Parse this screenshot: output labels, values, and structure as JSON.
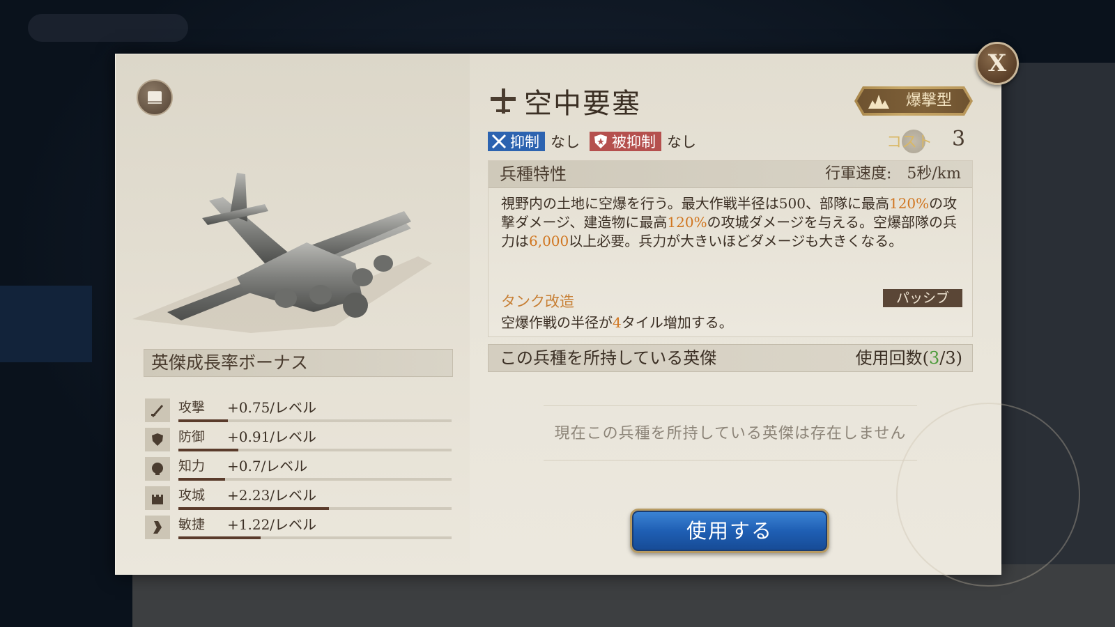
{
  "dialog": {
    "close_label": "X",
    "title": "空中要塞",
    "type_badge": "爆撃型",
    "counters": {
      "suppress_label": "抑制",
      "suppress_value": "なし",
      "suppressed_label": "被抑制",
      "suppressed_value": "なし"
    },
    "cost_label": "コスト",
    "cost_value": "3"
  },
  "traits": {
    "header": "兵種特性",
    "march_speed": "行軍速度:　5秒/km",
    "desc_parts": [
      "視野内の土地に空爆を行う。最大作戦半径は500、部隊に最高",
      "120%",
      "の攻撃ダメージ、建造物に最高",
      "120%",
      "の攻城ダメージを与える。空爆部隊の兵力は",
      "6,000",
      "以上必要。兵力が大きいほどダメージも大きくなる。"
    ],
    "skill_name": "タンク改造",
    "skill_tag": "パッシブ",
    "skill_desc_pre": "空爆作戦の半径が",
    "skill_desc_num": "4",
    "skill_desc_post": "タイル増加する。"
  },
  "heroes": {
    "header": "この兵種を所持している英傑",
    "usage_label": "使用回数(",
    "usage_current": "3",
    "usage_rest": "/3)",
    "empty_message": "現在この兵種を所持している英傑は存在しません"
  },
  "growth": {
    "header": "英傑成長率ボーナス",
    "stats": [
      {
        "label": "攻撃",
        "value": "+0.75/レベル",
        "fill": 0.18,
        "icon": "sword-icon"
      },
      {
        "label": "防御",
        "value": "+0.91/レベル",
        "fill": 0.22,
        "icon": "shield-icon"
      },
      {
        "label": "知力",
        "value": "+0.7/レベル",
        "fill": 0.17,
        "icon": "head-icon"
      },
      {
        "label": "攻城",
        "value": "+2.23/レベル",
        "fill": 0.55,
        "icon": "castle-icon"
      },
      {
        "label": "敏捷",
        "value": "+1.22/レベル",
        "fill": 0.3,
        "icon": "boot-icon"
      }
    ]
  },
  "actions": {
    "use_button": "使用する"
  },
  "colors": {
    "accent_blue": "#2c63b0",
    "accent_red": "#b5504e",
    "highlight_orange": "#d0751f",
    "usage_green": "#4c9a3a"
  }
}
